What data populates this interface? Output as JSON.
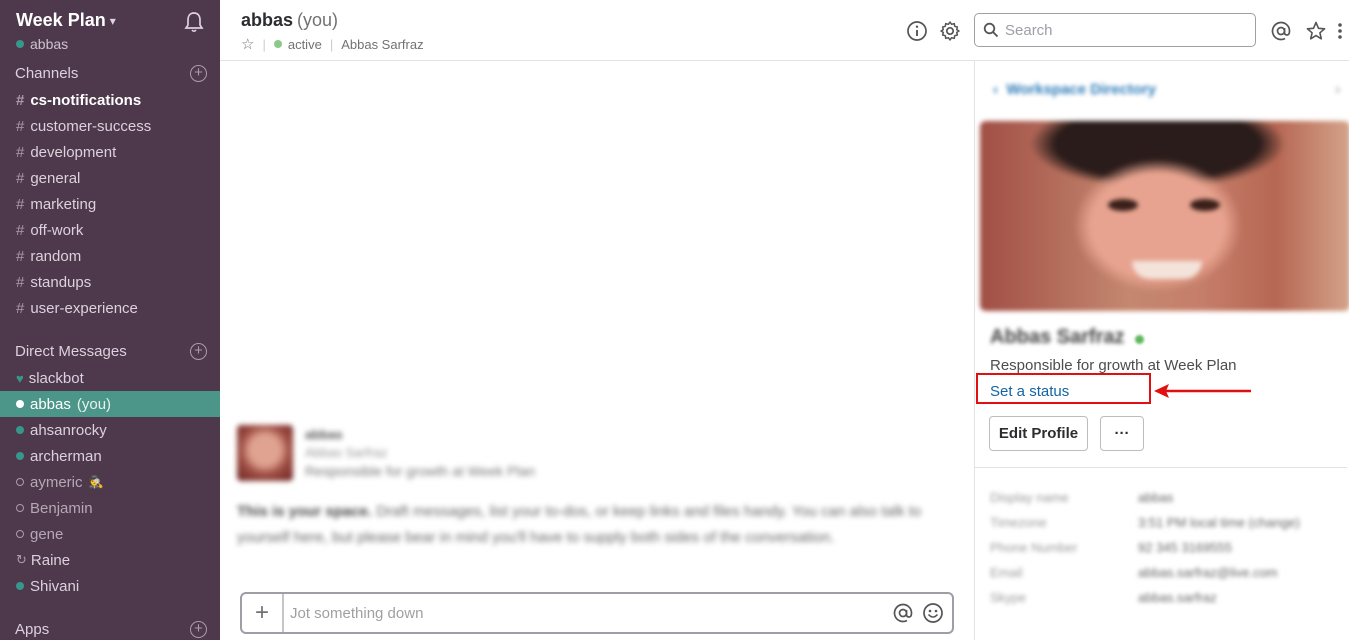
{
  "workspace": {
    "name": "Week Plan",
    "current_user": "abbas"
  },
  "sidebar": {
    "channels_label": "Channels",
    "channels": [
      {
        "name": "cs-notifications",
        "bold": true
      },
      {
        "name": "customer-success"
      },
      {
        "name": "development"
      },
      {
        "name": "general"
      },
      {
        "name": "marketing"
      },
      {
        "name": "off-work"
      },
      {
        "name": "random"
      },
      {
        "name": "standups"
      },
      {
        "name": "user-experience"
      }
    ],
    "dm_label": "Direct Messages",
    "dms": [
      {
        "name": "slackbot",
        "icon": "heart-icon"
      },
      {
        "name": "abbas",
        "suffix": "(you)",
        "active": true
      },
      {
        "name": "ahsanrocky",
        "presence": "active"
      },
      {
        "name": "archerman",
        "presence": "active"
      },
      {
        "name": "aymeric",
        "presence": "away",
        "emoji": "🕵"
      },
      {
        "name": "Benjamin",
        "presence": "away"
      },
      {
        "name": "gene",
        "presence": "away"
      },
      {
        "name": "Raine",
        "icon": "refresh-icon"
      },
      {
        "name": "Shivani",
        "presence": "active"
      }
    ],
    "apps_label": "Apps"
  },
  "header": {
    "title": "abbas",
    "title_suffix": "(you)",
    "status": "active",
    "full_name": "Abbas Sarfraz",
    "search_placeholder": "Search"
  },
  "intro": {
    "name": "abbas",
    "full_name": "Abbas Sarfraz",
    "title": "Responsible for growth at Week Plan",
    "text_bold": "This is your space.",
    "text": " Draft messages, list your to-dos, or keep links and files handy. You can also talk to yourself here, but please bear in mind you'll have to supply both sides of the conversation."
  },
  "composer": {
    "placeholder": "Jot something down"
  },
  "profile_panel": {
    "directory_label": "Workspace Directory",
    "name": "Abbas Sarfraz",
    "title": "Responsible for growth at Week Plan",
    "set_status_label": "Set a status",
    "edit_profile_label": "Edit Profile",
    "more_label": "···",
    "fields": [
      {
        "k": "Display name",
        "v": "abbas"
      },
      {
        "k": "Timezone",
        "v": "3:51 PM local time (change)"
      },
      {
        "k": "Phone Number",
        "v": "92 345 3169555"
      },
      {
        "k": "Email",
        "v": "abbas.sarfraz@live.com"
      },
      {
        "k": "Skype",
        "v": "abbas.sarfraz"
      }
    ]
  },
  "colors": {
    "sidebar_bg": "#4d394b",
    "active_item": "#4c9689",
    "link": "#1264a3",
    "annotation": "#e10f0f"
  }
}
